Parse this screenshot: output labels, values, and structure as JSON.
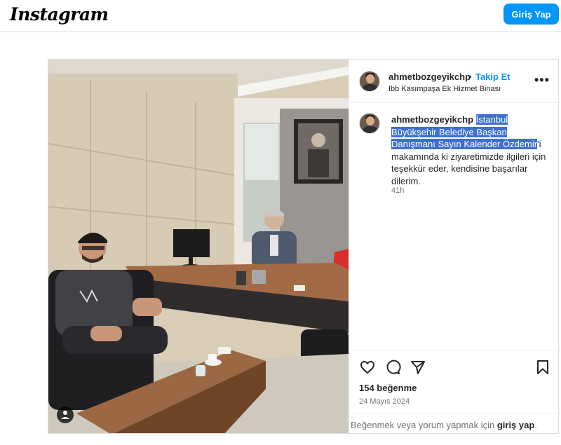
{
  "header": {
    "logo_text": "Instagram",
    "login_button": "Giriş Yap",
    "accent_color": "#0095f6"
  },
  "post": {
    "username": "ahmetbozgeyikchp",
    "separator": "•",
    "follow_label": "Takip Et",
    "location": "Ibb Kasımpaşa Ek Hizmet Binası",
    "more_icon": "more-horizontal-icon",
    "caption": {
      "username": "ahmetbozgeyikchp",
      "highlighted_text": "İstanbul Büyükşehir Belediye Başkan Danışmanı Sayın Kalender Özdemir",
      "rest_text": "'i makamında ki ziyaretimizde ilgileri için teşekkür eder, kendisine başarılar dilerim."
    },
    "time_ago": "41h",
    "actions": {
      "like_icon": "heart-icon",
      "comment_icon": "comment-icon",
      "share_icon": "share-icon",
      "save_icon": "bookmark-icon"
    },
    "likes": "154 beğenme",
    "date": "24 Mayıs 2024",
    "login_prompt": "Beğenmek veya yorum yapmak için",
    "login_link": "giriş yap",
    "login_suffix": "."
  }
}
